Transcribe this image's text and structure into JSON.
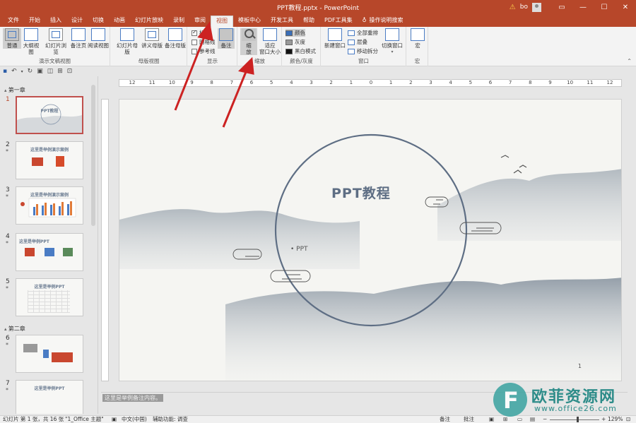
{
  "window": {
    "title": "PPT教程.pptx  -  PowerPoint",
    "warning_icon": "warning-icon",
    "user": "bo",
    "minimize": "—",
    "restore": "☐",
    "close": "✕"
  },
  "tabs": [
    "文件",
    "开始",
    "插入",
    "设计",
    "切换",
    "动画",
    "幻灯片放映",
    "录制",
    "审阅",
    "视图",
    "模板中心",
    "开发工具",
    "帮助",
    "PDF工具集",
    "操作说明搜索"
  ],
  "active_tab": "视图",
  "ribbon": {
    "presentation_views": {
      "label": "演示文稿视图",
      "buttons": [
        "普通",
        "大纲视图",
        "幻灯片浏览",
        "备注页",
        "阅读视图"
      ]
    },
    "master_views": {
      "label": "母版视图",
      "buttons": [
        "幻灯片母版",
        "讲义母版",
        "备注母版"
      ]
    },
    "show": {
      "label": "显示",
      "items": [
        "标尺",
        "网格线",
        "参考线"
      ],
      "notes": "备注"
    },
    "zoom": {
      "label": "缩放",
      "zoom": "缩\n放",
      "fit": "适应\n窗口大小"
    },
    "color": {
      "label": "颜色/灰度",
      "items": [
        "颜色",
        "灰度",
        "黑白模式"
      ]
    },
    "window": {
      "label": "窗口",
      "new_window": "新建窗口",
      "items": [
        "全部重排",
        "层叠",
        "移动拆分"
      ],
      "switch": "切换窗口"
    },
    "macros": {
      "label": "宏",
      "button": "宏"
    }
  },
  "ruler_ticks": [
    "12",
    "11",
    "10",
    "9",
    "8",
    "7",
    "6",
    "5",
    "4",
    "3",
    "2",
    "1",
    "0",
    "1",
    "2",
    "3",
    "4",
    "5",
    "6",
    "7",
    "8",
    "9",
    "10",
    "11",
    "12"
  ],
  "thumbnails": {
    "sections": [
      "第一章",
      "第二章"
    ],
    "slides": [
      {
        "num": "1",
        "title": "PPT教程"
      },
      {
        "num": "2",
        "title": "这里是举例演示案例"
      },
      {
        "num": "3",
        "title": "这里是举例演示案例"
      },
      {
        "num": "4",
        "title": "这里是举例PPT"
      },
      {
        "num": "5",
        "title": "这里是举例PPT"
      },
      {
        "num": "6",
        "title": ""
      },
      {
        "num": "7",
        "title": "这里是举例PPT"
      }
    ],
    "star": "*"
  },
  "slide": {
    "title": "PPT教程",
    "bullet": "PPT",
    "page_number": "1"
  },
  "notes": "这里是举例备注内容。",
  "status": {
    "slide_info": "幻灯片 第 1 张，共 16 张",
    "theme": "\"1_Office 主题\"",
    "language": "中文(中国)",
    "accessibility": "辅助功能: 调查",
    "notes_btn": "备注",
    "comments_btn": "批注",
    "zoom": "129%"
  },
  "watermark": {
    "cn": "欧菲资源网",
    "url": "www.office26.com"
  },
  "colors": {
    "accent": "#b7472a",
    "slide_title": "#5e6e84",
    "arrow": "#cc2222"
  }
}
